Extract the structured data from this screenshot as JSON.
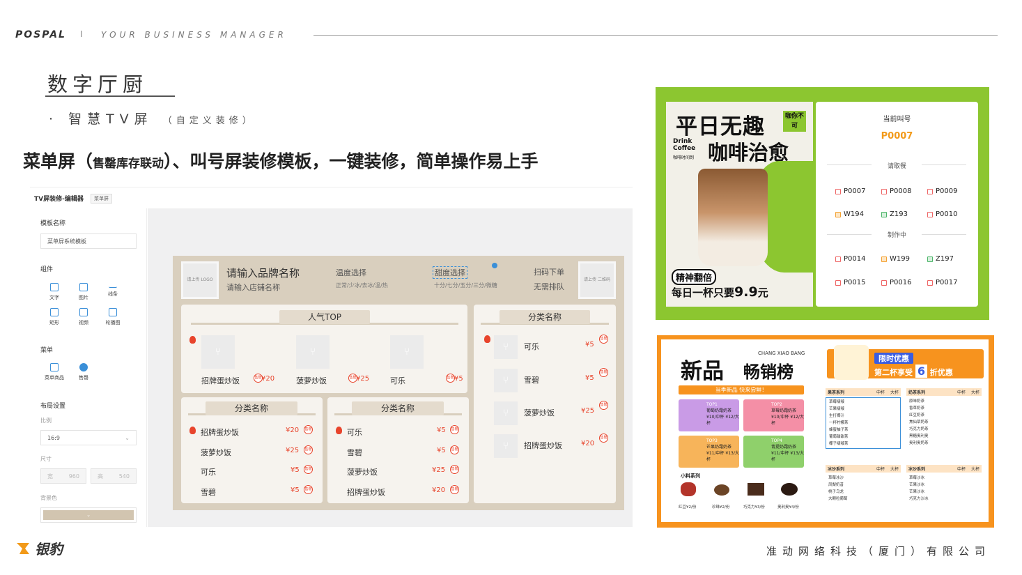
{
  "header": {
    "brand": "POSPAL",
    "separator": "I",
    "tagline": "YOUR BUSINESS MANAGER"
  },
  "slide": {
    "title": "数字厅厨",
    "subtitle": "· 智慧TV屏",
    "subtitle_note": "（自定义装修）",
    "headline_a": "菜单屏（",
    "headline_small": "售罄库存联动",
    "headline_b": "）、叫号屏装修模板，一键装修，简单操作易上手"
  },
  "footer": {
    "logo_text": "银豹",
    "company": "准动网络科技（厦门）有限公司"
  },
  "editor": {
    "title": "TV屏装修-编辑器",
    "tag": "菜单屏",
    "template_name_label": "模板名称",
    "template_name_value": "菜单屏系统模板",
    "components_label": "组件",
    "components": [
      {
        "label": "文字",
        "icon": "text-icon"
      },
      {
        "label": "图片",
        "icon": "image-icon"
      },
      {
        "label": "线条",
        "icon": "line-icon"
      },
      {
        "label": "矩形",
        "icon": "rect-icon"
      },
      {
        "label": "视频",
        "icon": "video-icon"
      },
      {
        "label": "轮播图",
        "icon": "carousel-icon"
      }
    ],
    "menu_label": "菜单",
    "menu_items": [
      {
        "label": "菜单商品",
        "icon": "menu-goods-icon"
      },
      {
        "label": "售罄",
        "icon": "soldout-icon"
      }
    ],
    "layout_label": "布局设置",
    "ratio_label": "比例",
    "ratio_value": "16:9",
    "size_label": "尺寸",
    "width_prefix": "宽",
    "width_value": "960",
    "height_prefix": "高",
    "height_value": "540",
    "bg_label": "背景色",
    "bg_color": "#d2c5b0"
  },
  "board": {
    "logo_placeholder_left": "请上传 LOGO",
    "logo_placeholder_right": "请上传 二维码",
    "brand_name": "请输入品牌名称",
    "store_name": "请输入店铺名称",
    "temp_title": "温度选择",
    "temp_options": "正常/少冰/去冰/温/热",
    "sweet_title": "甜度选择",
    "sweet_options": "十分/七分/五分/三分/微糖",
    "scan_title": "扫码下单",
    "scan_note": "无需排队",
    "soldout_badge": "售罄",
    "top_panel": {
      "title": "人气TOP",
      "items": [
        {
          "name": "招牌蛋炒饭",
          "price": "¥20"
        },
        {
          "name": "菠萝炒饭",
          "price": "¥25"
        },
        {
          "name": "可乐",
          "price": "¥5"
        }
      ]
    },
    "right_panel": {
      "title": "分类名称",
      "items": [
        {
          "name": "可乐",
          "price": "¥5"
        },
        {
          "name": "雪碧",
          "price": "¥5"
        },
        {
          "name": "菠萝炒饭",
          "price": "¥25"
        },
        {
          "name": "招牌蛋炒饭",
          "price": "¥20"
        }
      ]
    },
    "left_list": {
      "title": "分类名称",
      "items": [
        {
          "name": "招牌蛋炒饭",
          "price": "¥20"
        },
        {
          "name": "菠萝炒饭",
          "price": "¥25"
        },
        {
          "name": "可乐",
          "price": "¥5"
        },
        {
          "name": "雪碧",
          "price": "¥5"
        }
      ]
    },
    "mid_list": {
      "title": "分类名称",
      "items": [
        {
          "name": "可乐",
          "price": "¥5"
        },
        {
          "name": "雪碧",
          "price": "¥5"
        },
        {
          "name": "菠萝炒饭",
          "price": "¥25"
        },
        {
          "name": "招牌蛋炒饭",
          "price": "¥20"
        }
      ]
    }
  },
  "tv": {
    "headline": "平日无趣",
    "side_tag": "咖你不可",
    "drink_en": "Drink Coffee",
    "drink_cn": "咖啡时间到",
    "headline2": "咖啡治愈",
    "energy": "精神翻倍",
    "promo_prefix": "每日一杯只要",
    "promo_price": "9.9",
    "promo_unit": "元",
    "current_label": "当前叫号",
    "current_no": "P0007",
    "pickup_label": "请取餐",
    "pickup": [
      "P0007",
      "P0008",
      "P0009",
      "W194",
      "Z193",
      "P0010"
    ],
    "making_label": "制作中",
    "making": [
      "P0014",
      "W199",
      "Z197",
      "P0015",
      "P0016",
      "P0017"
    ]
  },
  "poster": {
    "title": "新品",
    "title_en": "CHANG XIAO BANG",
    "title2": "畅销榜",
    "promo_a": "限时优惠",
    "promo_b": "第二杯享受",
    "promo_num": "6",
    "promo_c": "折优惠",
    "banner": "当季新品 快来尝鲜！",
    "top_cards": [
      {
        "rank": "TOP1",
        "name": "葡萄奶霜奶茶",
        "price": "¥10/中杯 ¥12/大杯",
        "color": "#c99be6"
      },
      {
        "rank": "TOP2",
        "name": "草莓奶霜奶茶",
        "price": "¥10/中杯 ¥12/大杯",
        "color": "#f48fa6"
      },
      {
        "rank": "TOP3",
        "name": "芒果奶霜奶茶",
        "price": "¥11/中杯 ¥13/大杯",
        "color": "#f7b45a"
      },
      {
        "rank": "TOP4",
        "name": "青提奶霜奶茶",
        "price": "¥11/中杯 ¥13/大杯",
        "color": "#8fd06b"
      }
    ],
    "snack_label": "小料系列",
    "snacks": [
      "红豆¥2/份",
      "珍珠¥2/份",
      "巧克力¥3/份",
      "奥利奥¥4/份"
    ],
    "series": [
      {
        "name": "果茶系列",
        "rows": [
          "草莓啵啵",
          "芒果啵啵",
          "生打椰汁",
          "一杯柠檬茶",
          "蜂蜜柚子茶",
          "葡萄甜甜茶",
          "椰子啵啵茶"
        ]
      },
      {
        "name": "奶茶系列",
        "rows": [
          "原味奶茶",
          "香草奶茶",
          "红豆奶茶",
          "焦仙草奶茶",
          "巧克力奶茶",
          "黑糖奥利奥",
          "奥利奥奶茶"
        ]
      },
      {
        "name": "冰沙系列",
        "rows": [
          "草莓冰沙",
          "凤梨奶昔",
          "桃子乌龙",
          "大颗粒葡萄"
        ]
      },
      {
        "name": "冰沙系列",
        "rows": [
          "草莓沙冰",
          "芒果沙冰",
          "芒果沙冰",
          "巧克力沙冰"
        ]
      }
    ],
    "size_mid": "中杯",
    "size_big": "大杯"
  }
}
